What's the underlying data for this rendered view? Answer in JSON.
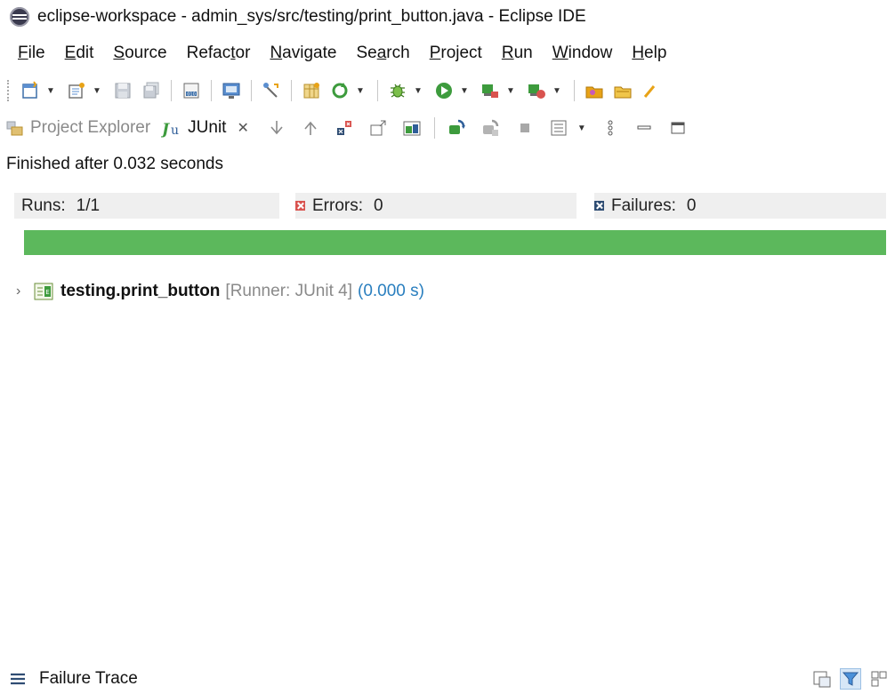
{
  "window": {
    "title": "eclipse-workspace - admin_sys/src/testing/print_button.java - Eclipse IDE"
  },
  "menu": [
    {
      "pre": "",
      "u": "F",
      "post": "ile"
    },
    {
      "pre": "",
      "u": "E",
      "post": "dit"
    },
    {
      "pre": "",
      "u": "S",
      "post": "ource"
    },
    {
      "pre": "Refac",
      "u": "t",
      "post": "or"
    },
    {
      "pre": "",
      "u": "N",
      "post": "avigate"
    },
    {
      "pre": "Se",
      "u": "a",
      "post": "rch"
    },
    {
      "pre": "",
      "u": "P",
      "post": "roject"
    },
    {
      "pre": "",
      "u": "R",
      "post": "un"
    },
    {
      "pre": "",
      "u": "W",
      "post": "indow"
    },
    {
      "pre": "",
      "u": "H",
      "post": "elp"
    }
  ],
  "views": {
    "project_explorer": "Project Explorer",
    "junit": "JUnit",
    "close_glyph": "✕"
  },
  "status": "Finished after 0.032 seconds",
  "counters": {
    "runs_label": "Runs:",
    "runs_value": "1/1",
    "errors_label": "Errors:",
    "errors_value": "0",
    "failures_label": "Failures:",
    "failures_value": "0"
  },
  "progress": {
    "fraction": 1.0,
    "color": "#5cb85c"
  },
  "tree": {
    "expand_glyph": "›",
    "suite": "testing.print_button",
    "runner": "[Runner: JUnit 4]",
    "time": "(0.000 s)"
  },
  "failure_trace": {
    "title": "Failure Trace"
  },
  "icons": {
    "toolbar": [
      "new-wizard-icon",
      "new-java-icon",
      "save-icon",
      "save-all-icon",
      "binary-icon",
      "console-icon",
      "tools-icon",
      "package-icon",
      "refresh-icon",
      "debug-icon",
      "run-icon",
      "run-external-icon",
      "coverage-icon",
      "open-folder-icon",
      "open-type-icon"
    ],
    "junit_view": [
      "next-failure-icon",
      "previous-failure-icon",
      "show-failures-only-icon",
      "scroll-lock-icon",
      "history-icon",
      "rerun-icon",
      "rerun-failed-icon",
      "stop-icon",
      "layout-icon",
      "view-menu-icon",
      "minimize-icon",
      "maximize-icon"
    ]
  }
}
